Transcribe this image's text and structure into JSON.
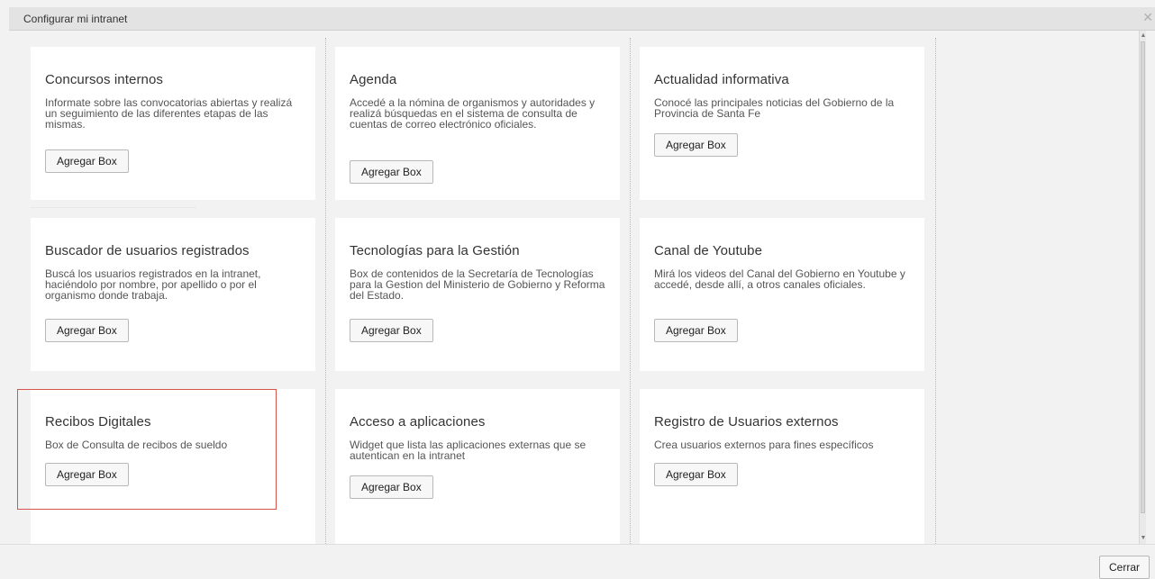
{
  "dialog": {
    "title": "Configurar mi intranet",
    "close_icon": "close-icon",
    "close_glyph": "✕"
  },
  "cards": [
    {
      "title": "Concursos internos",
      "description": "Informate sobre las convocatorias abiertas y realizá un seguimiento de las diferentes etapas de las mismas.",
      "button": "Agregar Box"
    },
    {
      "title": "Agenda",
      "description": "Accedé a la nómina de organismos y autoridades y realizá búsquedas en el sistema de consulta de cuentas de correo electrónico oficiales.",
      "button": "Agregar Box"
    },
    {
      "title": "Actualidad informativa",
      "description": "Conocé las principales noticias del Gobierno de la Provincia de Santa Fe",
      "button": "Agregar Box"
    },
    {
      "title": "Buscador de usuarios registrados",
      "description": "Buscá los usuarios registrados en la intranet, haciéndolo por nombre, por apellido o por el organismo donde trabaja.",
      "button": "Agregar Box"
    },
    {
      "title": "Tecnologías para la Gestión",
      "description": "Box de contenidos de la Secretaría de Tecnologías para la Gestion del Ministerio de Gobierno y Reforma del Estado.",
      "button": "Agregar Box"
    },
    {
      "title": "Canal de Youtube",
      "description": "Mirá los videos del Canal del Gobierno en Youtube y accedé, desde allí, a otros canales oficiales.",
      "button": "Agregar Box"
    },
    {
      "title": "Recibos Digitales",
      "description": "Box de Consulta de recibos de sueldo",
      "button": "Agregar Box",
      "highlighted": true
    },
    {
      "title": "Acceso a aplicaciones",
      "description": "Widget que lista las aplicaciones externas que se autentican en la intranet",
      "button": "Agregar Box"
    },
    {
      "title": "Registro de Usuarios externos",
      "description": "Crea usuarios externos para fines específicos",
      "button": "Agregar Box"
    }
  ],
  "footer": {
    "close_button": "Cerrar"
  },
  "colors": {
    "highlight_border": "#d9534f",
    "header_bg": "#e3e3e3",
    "page_bg": "#f2f2f2"
  }
}
